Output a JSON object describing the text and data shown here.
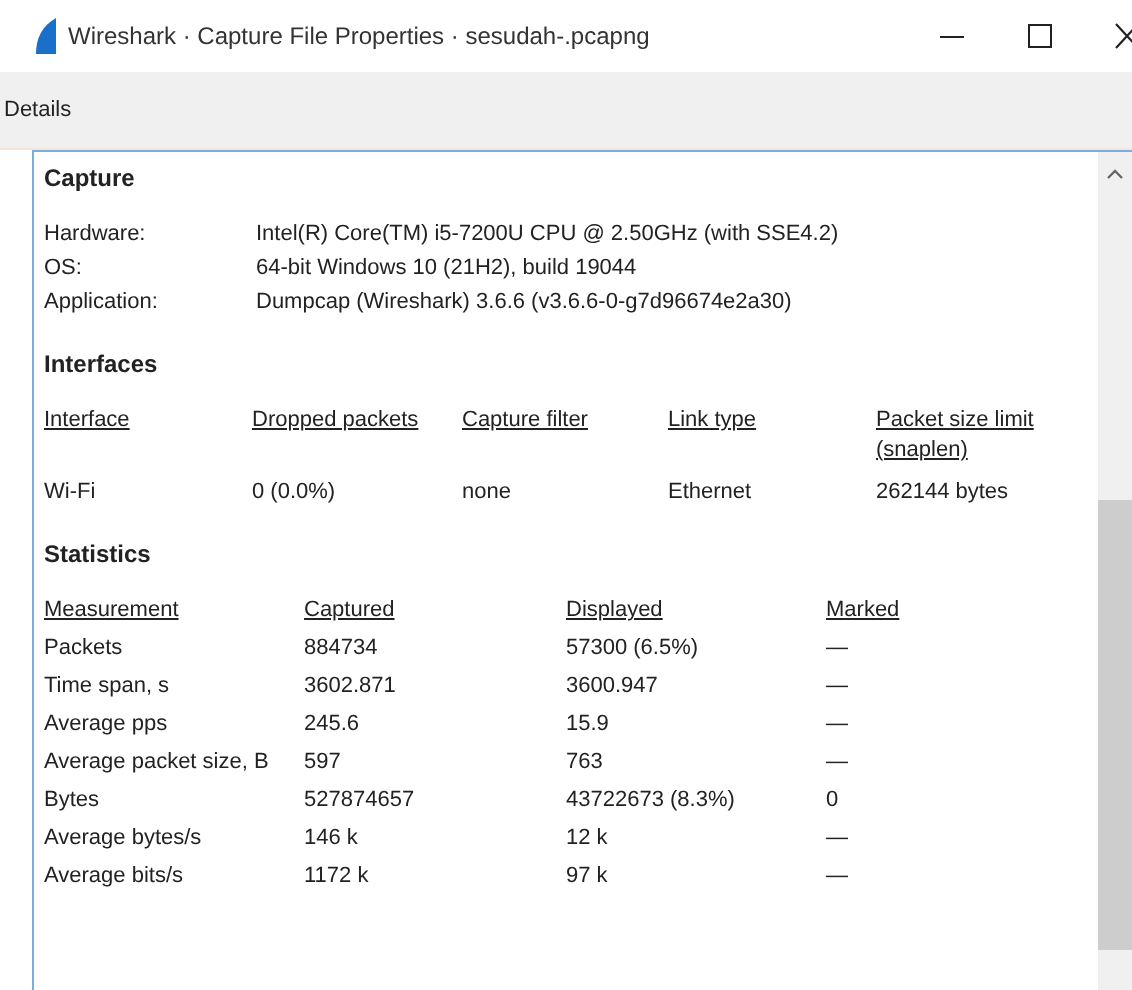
{
  "window": {
    "title": "Wireshark · Capture File Properties · sesudah-.pcapng"
  },
  "pane_label": "Details",
  "sections": [
    {
      "kind": "properties",
      "heading": "Capture",
      "rows": [
        {
          "label": "Hardware:",
          "value": "Intel(R) Core(TM) i5-7200U CPU @ 2.50GHz (with SSE4.2)"
        },
        {
          "label": "OS:",
          "value": "64-bit Windows 10 (21H2), build 19044"
        },
        {
          "label": "Application:",
          "value": "Dumpcap (Wireshark) 3.6.6 (v3.6.6-0-g7d96674e2a30)"
        }
      ]
    },
    {
      "kind": "interfaces",
      "heading": "Interfaces",
      "columns": [
        "Interface",
        "Dropped packets",
        "Capture filter",
        "Link type",
        "Packet size limit (snaplen)"
      ],
      "rows": [
        [
          "Wi-Fi",
          "0 (0.0%)",
          "none",
          "Ethernet",
          "262144 bytes"
        ]
      ]
    },
    {
      "kind": "statistics",
      "heading": "Statistics",
      "columns": [
        "Measurement",
        "Captured",
        "Displayed",
        "Marked"
      ],
      "rows": [
        [
          "Packets",
          "884734",
          "57300 (6.5%)",
          "—"
        ],
        [
          "Time span, s",
          "3602.871",
          "3600.947",
          "—"
        ],
        [
          "Average pps",
          "245.6",
          "15.9",
          "—"
        ],
        [
          "Average packet size, B",
          "597",
          "763",
          "—"
        ],
        [
          "Bytes",
          "527874657",
          "43722673 (8.3%)",
          "0"
        ],
        [
          "Average bytes/s",
          "146 k",
          "12 k",
          "—"
        ],
        [
          "Average bits/s",
          "1172 k",
          "97 k",
          "—"
        ]
      ]
    }
  ]
}
